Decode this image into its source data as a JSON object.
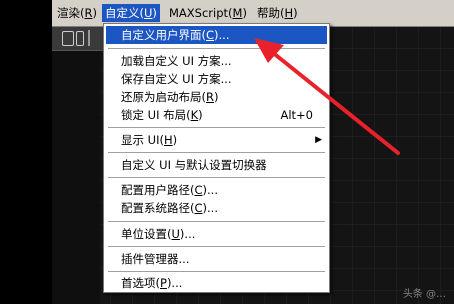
{
  "menubar": {
    "items": [
      {
        "text": "渲染(",
        "key": "R",
        "tail": ")"
      },
      {
        "text": "自定义(",
        "key": "U",
        "tail": ")"
      },
      {
        "text": "MAXScript(",
        "key": "M",
        "tail": ")"
      },
      {
        "text": "帮助(",
        "key": "H",
        "tail": ")"
      }
    ]
  },
  "dropdown": {
    "items": [
      {
        "pre": "自定义用户界面(",
        "key": "C",
        "post": ")...",
        "shortcut": ""
      },
      {
        "pre": "加载自定义 UI 方案...",
        "key": "",
        "post": "",
        "shortcut": ""
      },
      {
        "pre": "保存自定义 UI 方案...",
        "key": "",
        "post": "",
        "shortcut": ""
      },
      {
        "pre": "还原为启动布局(",
        "key": "R",
        "post": ")",
        "shortcut": ""
      },
      {
        "pre": "锁定 UI 布局(",
        "key": "K",
        "post": ")",
        "shortcut": "Alt+0"
      },
      {
        "pre": "显示 UI(",
        "key": "H",
        "post": ")",
        "shortcut": ""
      },
      {
        "pre": "自定义 UI 与默认设置切换器",
        "key": "",
        "post": "",
        "shortcut": ""
      },
      {
        "pre": "配置用户路径(",
        "key": "C",
        "post": ")...",
        "shortcut": ""
      },
      {
        "pre": "配置系统路径(",
        "key": "C",
        "post": ")...",
        "shortcut": ""
      },
      {
        "pre": "单位设置(",
        "key": "U",
        "post": ")...",
        "shortcut": ""
      },
      {
        "pre": "插件管理器...",
        "key": "",
        "post": "",
        "shortcut": ""
      },
      {
        "pre": "首选项(",
        "key": "P",
        "post": ")...",
        "shortcut": ""
      }
    ]
  },
  "watermark": "头条 @…",
  "colors": {
    "highlight": "#1c56c3",
    "annotation_arrow": "#e8212b"
  },
  "icons": [
    "submenu-arrow-icon",
    "annotation-arrow-icon"
  ]
}
